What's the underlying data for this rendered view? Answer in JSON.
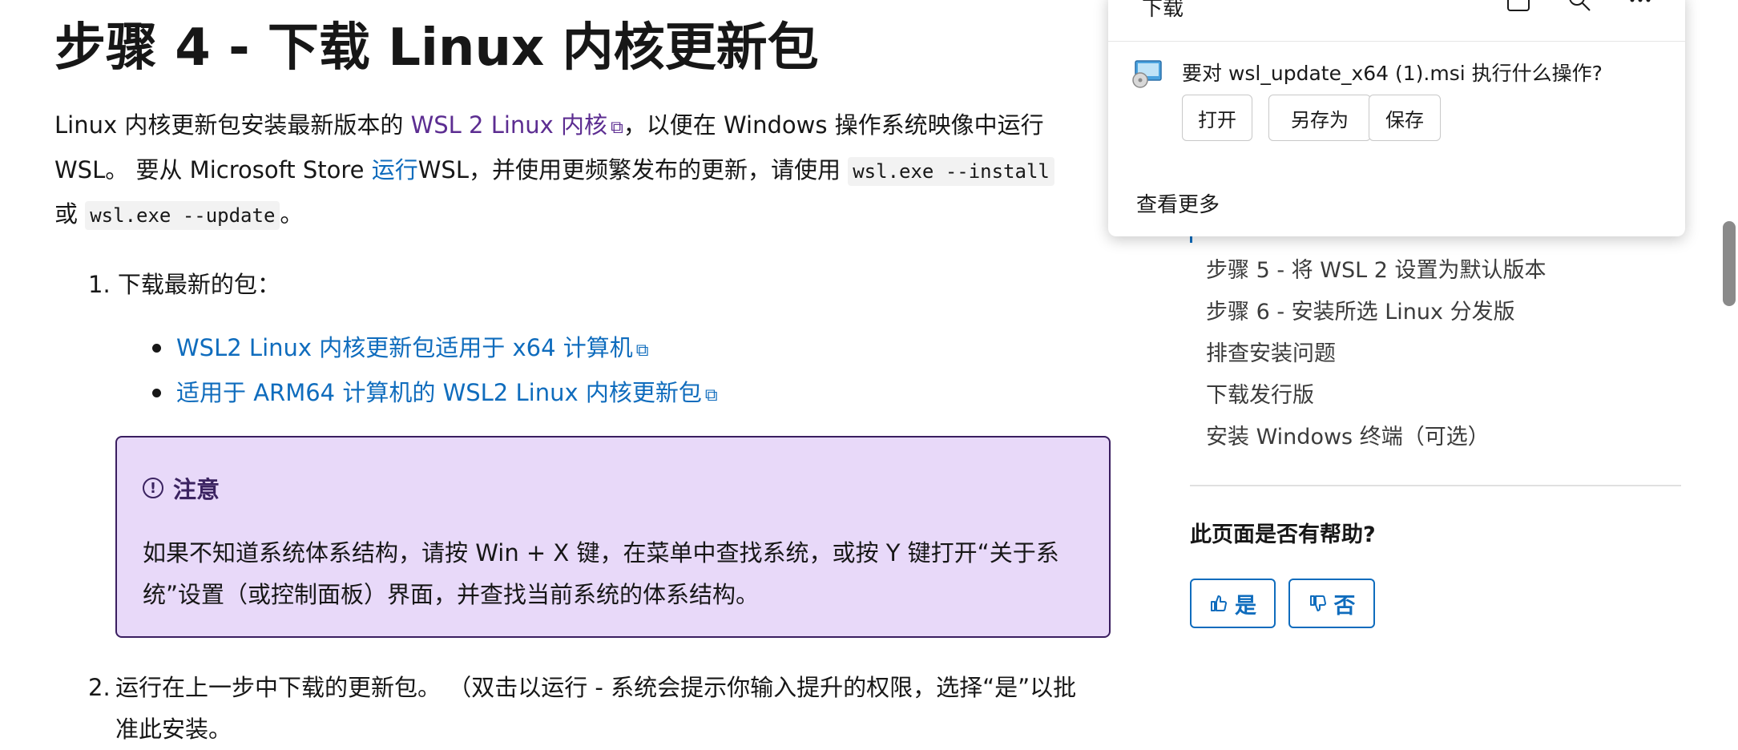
{
  "article": {
    "title": "步骤 4 - 下载 Linux 内核更新包",
    "intro": {
      "t1": "Linux 内核更新包安装最新版本的 ",
      "link1": "WSL 2 Linux 内核",
      "t2": "，以便在 Windows 操作系统映像中运行",
      "t3": "WSL。 要从 Microsoft Store ",
      "link2": "运行",
      "t4": "WSL，并使用更频繁发布的更新，请使用 ",
      "code1": "wsl.exe --install",
      "t5": "或 ",
      "code2": "wsl.exe --update",
      "t6": "。"
    },
    "step1": "1. 下载最新的包：",
    "packages": [
      "WSL2 Linux 内核更新包适用于 x64 计算机",
      "适用于 ARM64 计算机的 WSL2 Linux 内核更新包"
    ],
    "note": {
      "title": "注意",
      "body": "如果不知道系统体系结构，请按 Win + X 键，在菜单中查找系统，或按 Y 键打开“关于系统”设置（或控制面板）界面，并查找当前系统的体系结构。"
    },
    "step2_num": "2.",
    "step2": "运行在上一步中下载的更新包。 （双击以运行 - 系统会提示你输入提升的权限，选择“是”以批准此安装。"
  },
  "toc": {
    "items": [
      "步骤 5 - 将 WSL 2 设置为默认版本",
      "步骤 6 - 安装所选 Linux 分发版",
      "排查安装问题",
      "下载发行版",
      "安装 Windows 终端（可选）"
    ]
  },
  "feedback": {
    "question": "此页面是否有帮助?",
    "yes": "是",
    "no": "否"
  },
  "download_flyout": {
    "title": "下载",
    "question": "要对 wsl_update_x64 (1).msi 执行什么操作?",
    "open": "打开",
    "save_as": "另存为",
    "save": "保存",
    "see_more": "查看更多"
  },
  "colors": {
    "link_blue": "#0f6cbd",
    "link_visited": "#5c2d91",
    "note_bg": "#e8d9f9",
    "note_border": "#3a1e60"
  }
}
